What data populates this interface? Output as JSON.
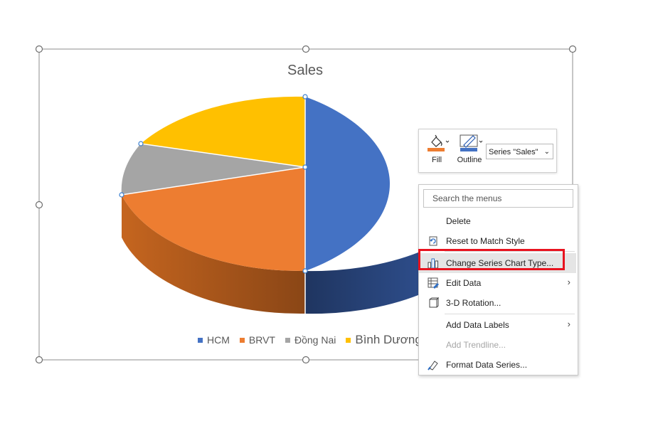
{
  "chart": {
    "title": "Sales",
    "legend": [
      {
        "label": "HCM",
        "color": "#4472c4"
      },
      {
        "label": "BRVT",
        "color": "#ed7d31"
      },
      {
        "label": "Đồng Nai",
        "color": "#a5a5a5"
      },
      {
        "label": "Bình Dương",
        "color": "#ffc000"
      }
    ]
  },
  "chart_data": {
    "type": "pie",
    "title": "Sales",
    "categories": [
      "HCM",
      "BRVT",
      "Đồng Nai",
      "Bình Dương"
    ],
    "values": [
      50,
      21,
      10,
      19
    ],
    "colors": [
      "#4472c4",
      "#ed7d31",
      "#a5a5a5",
      "#ffc000"
    ],
    "style": "3-D pie",
    "legend_position": "bottom"
  },
  "mini_toolbar": {
    "fill_label": "Fill",
    "outline_label": "Outline",
    "series_select": "Series \"Sales\"",
    "fill_color": "#ed7d31",
    "outline_color": "#4472c4"
  },
  "context_menu": {
    "search_placeholder": "Search the menus",
    "items": [
      {
        "label": "Delete",
        "icon": "none"
      },
      {
        "label": "Reset to Match Style",
        "icon": "reset-style-icon"
      },
      {
        "label": "Change Series Chart Type...",
        "icon": "chart-type-icon"
      },
      {
        "label": "Edit Data",
        "icon": "edit-data-icon"
      },
      {
        "label": "3-D Rotation...",
        "icon": "rotation-3d-icon"
      },
      {
        "label": "Add Data Labels",
        "icon": "none"
      },
      {
        "label": "Add Trendline...",
        "icon": "none"
      },
      {
        "label": "Format Data Series...",
        "icon": "format-series-icon"
      }
    ],
    "highlight_color": "#e8131f"
  }
}
